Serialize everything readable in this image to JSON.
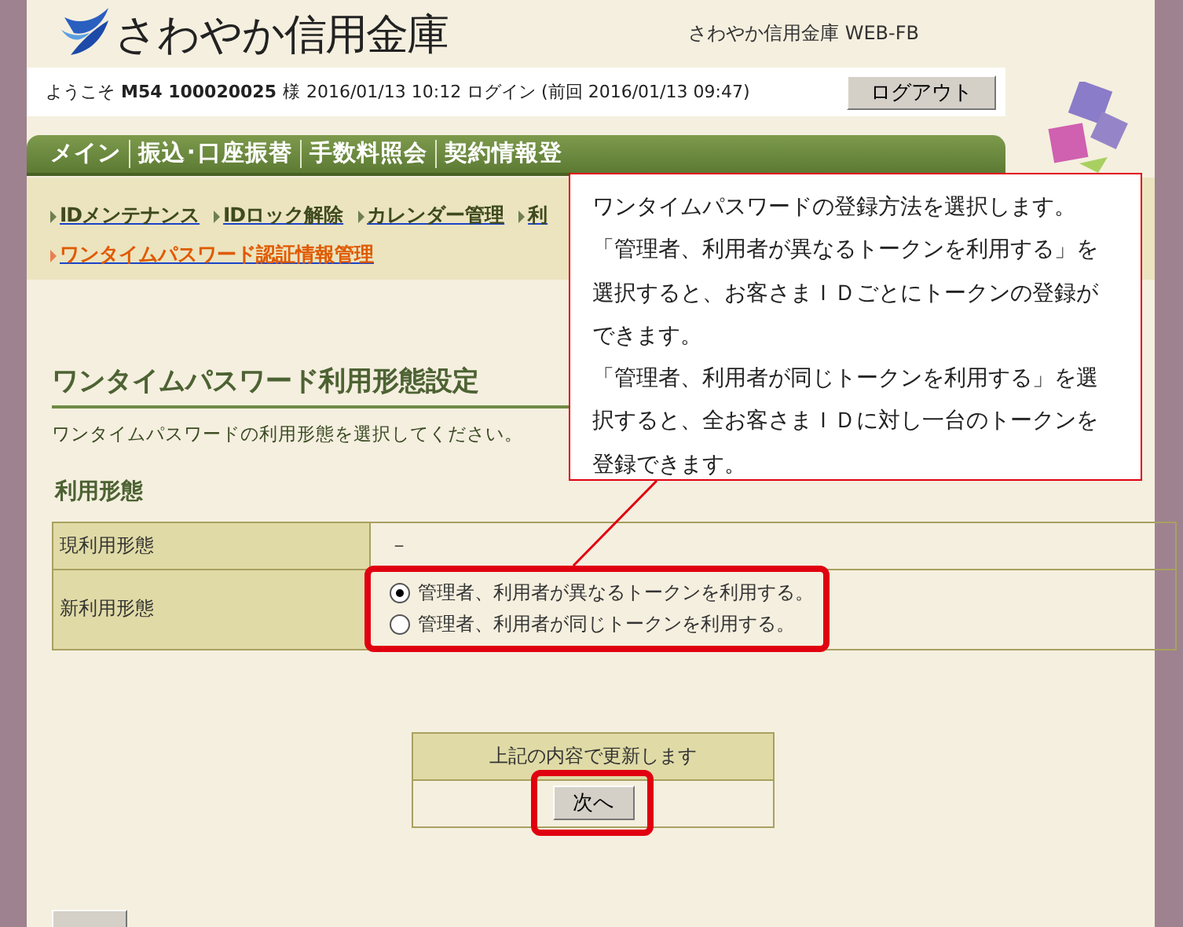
{
  "header": {
    "logo_text": "さわやか信用金庫",
    "site_label": "さわやか信用金庫  WEB-FB"
  },
  "welcome": {
    "greeting": "ようこそ",
    "user_id": "M54 100020025",
    "honorific": "様",
    "login_info": "2016/01/13 10:12 ログイン (前回 2016/01/13 09:47)",
    "logout_button": "ログアウト"
  },
  "main_nav": [
    {
      "label": "メイン"
    },
    {
      "label": "振込･口座振替"
    },
    {
      "label": "手数料照会"
    },
    {
      "label": "契約情報登"
    }
  ],
  "sub_nav": [
    {
      "label": "IDメンテナンス",
      "selected": false
    },
    {
      "label": "IDロック解除",
      "selected": false
    },
    {
      "label": "カレンダー管理",
      "selected": false
    },
    {
      "label": "利",
      "selected": false
    },
    {
      "label": "ワンタイムパスワード認証情報管理",
      "selected": true
    }
  ],
  "page_title": "ワンタイムパスワード利用形態設定",
  "instruction": "ワンタイムパスワードの利用形態を選択してください。",
  "section_title": "利用形態",
  "form_rows": [
    {
      "kind": "text",
      "label": "現利用形態",
      "value": "－"
    },
    {
      "kind": "radio",
      "label": "新利用形態",
      "options": [
        {
          "label": "管理者、利用者が異なるトークンを利用する。",
          "selected": true
        },
        {
          "label": "管理者、利用者が同じトークンを利用する。",
          "selected": false
        }
      ]
    }
  ],
  "confirm": {
    "message": "上記の内容で更新します",
    "button": "次へ"
  },
  "callout": {
    "lines": [
      "ワンタイムパスワードの登録方法を選択します。",
      "「管理者、利用者が異なるトークンを利用する」を",
      "選択すると、お客さまＩＤごとにトークンの登録が",
      "できます。",
      "「管理者、利用者が同じトークンを利用する」を選",
      "択すると、全お客さまＩＤに対し一台のトークンを",
      "登録できます。"
    ]
  }
}
